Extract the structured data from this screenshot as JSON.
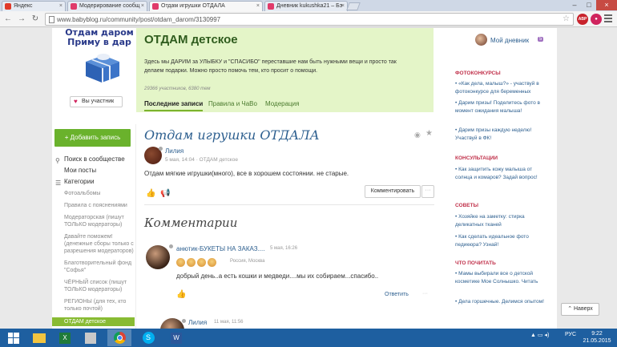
{
  "browser": {
    "tabs": [
      {
        "title": "Яндекс",
        "favicon_color": "#e03a2a",
        "active": false
      },
      {
        "title": "Модерирование сообщ",
        "favicon_color": "#e03a6a",
        "active": false
      },
      {
        "title": "Отдам игрушки ОТДАЛА",
        "favicon_color": "#e03a6a",
        "active": true
      },
      {
        "title": "Дневник kukushka21 – Бэ",
        "favicon_color": "#e03a6a",
        "active": false
      }
    ],
    "url": "www.babyblog.ru/community/post/otdam_darom/3130997",
    "extensions": [
      {
        "label": "ABP",
        "color": "#c8232c"
      },
      {
        "label": "●",
        "color": "#d0245e"
      }
    ]
  },
  "community": {
    "banner_text": "Отдам даром\nПриму в дар",
    "join_label": "Вы участник",
    "title": "ОТДАМ детское",
    "description": "Здесь мы ДАРИМ за УЛЫБКУ и \"СПАСИБО\" переставшие нам быть нужными вещи и просто так делаем подарки. Можно просто помочь тем, кто просит о помощи.",
    "stats": "29366 участников, 6380 тем",
    "tabs": [
      "Последние записи",
      "Правила и ЧаВо",
      "Модерация"
    ]
  },
  "sidebar": {
    "add_post": "Добавить запись",
    "items": [
      {
        "label": "Поиск в сообществе",
        "icon": "search-icon"
      },
      {
        "label": "Мои посты",
        "icon": ""
      },
      {
        "label": "Категории",
        "icon": "list-icon"
      }
    ],
    "categories": [
      {
        "label": "Фотоальбомы",
        "active": false
      },
      {
        "label": "Правила с пояснениями",
        "active": false
      },
      {
        "label": "Модераторская (пишут ТОЛЬКО модераторы)",
        "active": false
      },
      {
        "label": "Давайте поможем! (денежные сборы только с разрешения модераторов)",
        "active": false
      },
      {
        "label": "Благотворительный фонд \"Софья\"",
        "active": false
      },
      {
        "label": "ЧЁРНЫЙ список (пишут ТОЛЬКО модераторы)",
        "active": false
      },
      {
        "label": "РЕГИОНЫ (для тех, кто только почтой)",
        "active": false
      },
      {
        "label": "ОТДАМ детское",
        "active": true
      }
    ]
  },
  "post": {
    "title": "Отдам игрушки ОТДАЛА",
    "author": "Лилия",
    "meta": "5 мая, 14:04  ·  ОТДАМ детское",
    "body": "Отдам мягкие игрушки(много), все в хорошем состоянии. не старые.",
    "comment_button": "Комментировать",
    "more_button": "···"
  },
  "comments": {
    "title": "Комментарии",
    "items": [
      {
        "author": "анютик-БУКЕТЫ НА ЗАКАЗ....",
        "time": "5 мая, 16:26",
        "location": "Россия, Москва",
        "text": "добрый день..а есть кошки и медведи....мы их собираем...спасибо..",
        "reply": "Ответить"
      },
      {
        "author": "Лилия",
        "time": "11 мая, 11:56"
      }
    ]
  },
  "right_sidebar": {
    "my_diary": "Мой дневник",
    "my_diary_count": "5",
    "sections": [
      {
        "title": "ФОТОКОНКУРСЫ",
        "items": [
          "«Как дела, малыш?» - участвуй в фотоконкурсе для беременных",
          "Дарим призы! Поделитесь фото в момент ожидания малыша!",
          "Дарим призы каждую неделю! Участвуй в ФК!"
        ]
      },
      {
        "title": "КОНСУЛЬТАЦИИ",
        "items": [
          "Как защитить кожу малыша от солнца и комаров? Задай вопрос!"
        ]
      },
      {
        "title": "СОВЕТЫ",
        "items": [
          "Хозяйке на заметку: стирка деликатных тканей",
          "Как сделать идеальное фото педикюра? Узнай!"
        ]
      },
      {
        "title": "ЧТО ПОЧИТАТЬ",
        "items": [
          "Мамы выбирали все о детской косметике Мое Солнышко. Читать",
          "Дела горшечные. Делимся опытом!"
        ]
      }
    ]
  },
  "back_to_top": "Наверх",
  "taskbar": {
    "lang": "РУС",
    "time": "9:22",
    "date": "21.05.2015"
  }
}
